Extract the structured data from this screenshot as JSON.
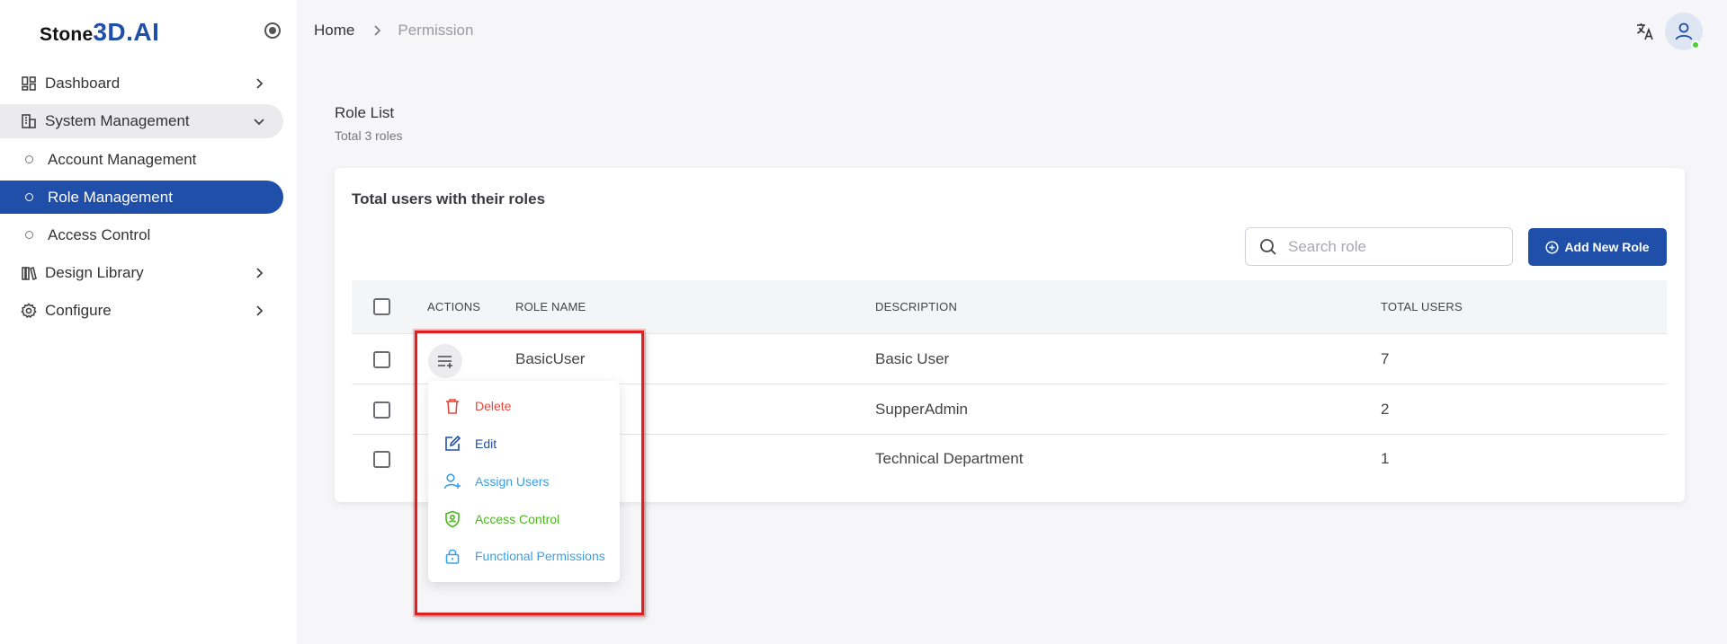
{
  "app": {
    "logo_part1": "Stone",
    "logo_part2": "3D.AI"
  },
  "sidebar": {
    "items": [
      {
        "label": "Dashboard",
        "icon": "dashboard-icon"
      },
      {
        "label": "System Management",
        "icon": "building-icon",
        "expanded": true,
        "children": [
          {
            "label": "Account Management"
          },
          {
            "label": "Role Management",
            "active": true
          },
          {
            "label": "Access Control"
          }
        ]
      },
      {
        "label": "Design Library",
        "icon": "library-icon"
      },
      {
        "label": "Configure",
        "icon": "gear-icon"
      }
    ]
  },
  "header": {
    "breadcrumb_home": "Home",
    "breadcrumb_current": "Permission"
  },
  "page": {
    "title": "Role List",
    "subtitle": "Total 3 roles"
  },
  "card": {
    "title": "Total users with their roles",
    "search_placeholder": "Search role",
    "add_button": "Add New Role"
  },
  "table": {
    "columns": [
      "ACTIONS",
      "ROLE NAME",
      "DESCRIPTION",
      "TOTAL USERS"
    ],
    "rows": [
      {
        "role_name": "BasicUser",
        "description": "Basic User",
        "total_users": "7"
      },
      {
        "role_name": "",
        "description": "SupperAdmin",
        "total_users": "2"
      },
      {
        "role_name": "",
        "description": "Technical Department",
        "total_users": "1"
      }
    ]
  },
  "action_menu": {
    "items": [
      {
        "label": "Delete",
        "icon": "trash-icon",
        "color": "#e5483d"
      },
      {
        "label": "Edit",
        "icon": "edit-icon",
        "color": "#1f4fa8"
      },
      {
        "label": "Assign Users",
        "icon": "user-plus-icon",
        "color": "#3aa0e8"
      },
      {
        "label": "Access Control",
        "icon": "shield-user-icon",
        "color": "#4cb81e"
      },
      {
        "label": "Functional Permissions",
        "icon": "lock-icon",
        "color": "#3aa0e8"
      }
    ]
  },
  "colors": {
    "primary": "#1f4fa8",
    "highlight": "#e02020",
    "online": "#4cd137"
  }
}
